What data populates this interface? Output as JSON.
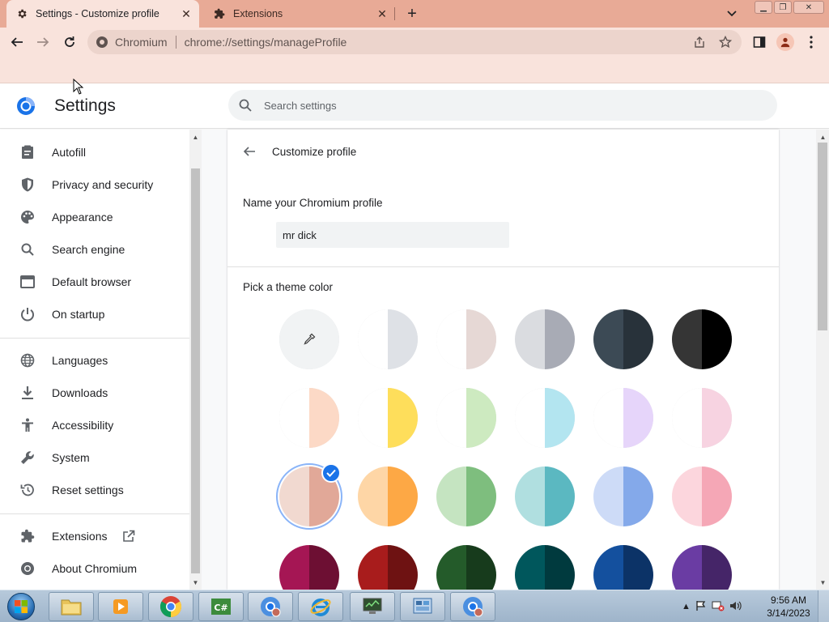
{
  "tabs": [
    {
      "title": "Settings - Customize profile",
      "icon": "gear-icon",
      "active": true
    },
    {
      "title": "Extensions",
      "icon": "puzzle-icon",
      "active": false
    }
  ],
  "toolbar": {
    "site_name": "Chromium",
    "url": "chrome://settings/manageProfile"
  },
  "settings": {
    "title": "Settings",
    "search_placeholder": "Search settings"
  },
  "sidebar": {
    "items": [
      {
        "label": "Autofill",
        "icon": "clipboard-icon"
      },
      {
        "label": "Privacy and security",
        "icon": "shield-icon"
      },
      {
        "label": "Appearance",
        "icon": "palette-icon"
      },
      {
        "label": "Search engine",
        "icon": "search-icon"
      },
      {
        "label": "Default browser",
        "icon": "browser-window-icon"
      },
      {
        "label": "On startup",
        "icon": "power-icon"
      },
      {
        "label": "Languages",
        "icon": "globe-icon"
      },
      {
        "label": "Downloads",
        "icon": "download-icon"
      },
      {
        "label": "Accessibility",
        "icon": "accessibility-icon"
      },
      {
        "label": "System",
        "icon": "wrench-icon"
      },
      {
        "label": "Reset settings",
        "icon": "reset-icon"
      },
      {
        "label": "Extensions",
        "icon": "puzzle-icon"
      },
      {
        "label": "About Chromium",
        "icon": "chromium-icon"
      }
    ]
  },
  "profile": {
    "page_title": "Customize profile",
    "name_label": "Name your Chromium profile",
    "name_value": "mr dick",
    "theme_label": "Pick a theme color",
    "swatches": [
      {
        "left": "#f1f3f4",
        "right": "#f1f3f4",
        "picker": true
      },
      {
        "left": "#ffffff",
        "right": "#dee1e6"
      },
      {
        "left": "#ffffff",
        "right": "#e6d8d5"
      },
      {
        "left": "#dadce0",
        "right": "#a8abb5"
      },
      {
        "left": "#3c4a55",
        "right": "#28323a"
      },
      {
        "left": "#353535",
        "right": "#000000"
      },
      {
        "left": "#ffffff",
        "right": "#fcd9c6"
      },
      {
        "left": "#ffffff",
        "right": "#fede5b"
      },
      {
        "left": "#ffffff",
        "right": "#cdeac0"
      },
      {
        "left": "#ffffff",
        "right": "#b3e5f0"
      },
      {
        "left": "#ffffff",
        "right": "#e6d5fa"
      },
      {
        "left": "#ffffff",
        "right": "#f7d3e1"
      },
      {
        "left": "#f1d9d0",
        "right": "#e1a898",
        "selected": true
      },
      {
        "left": "#fed6a6",
        "right": "#fda845"
      },
      {
        "left": "#c5e4c1",
        "right": "#7ebe7e"
      },
      {
        "left": "#b0dfe0",
        "right": "#5bb8c1"
      },
      {
        "left": "#cddbf7",
        "right": "#84a9ea"
      },
      {
        "left": "#fcd6dd",
        "right": "#f5a7b6"
      },
      {
        "left": "#a51654",
        "right": "#6d0f33"
      },
      {
        "left": "#a81c1c",
        "right": "#6e1212"
      },
      {
        "left": "#245b2a",
        "right": "#173b1c"
      },
      {
        "left": "#00575c",
        "right": "#003a3e"
      },
      {
        "left": "#14509e",
        "right": "#0c3367"
      },
      {
        "left": "#6a3ca3",
        "right": "#452568"
      }
    ]
  },
  "taskbar": {
    "time": "9:56 AM",
    "date": "3/14/2023"
  },
  "colors": {
    "tabstrip": "#e8aa96",
    "toolbar": "#f9e3dc",
    "accent": "#1a73e8"
  }
}
